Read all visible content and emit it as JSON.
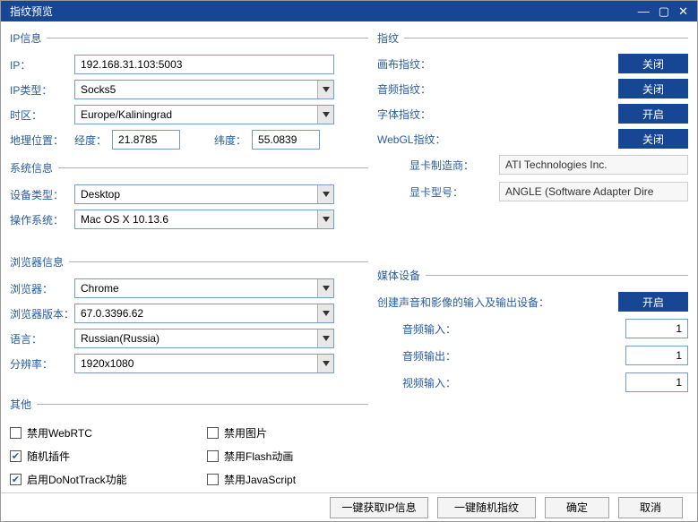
{
  "window": {
    "title": "指纹预览"
  },
  "sections": {
    "ip": "IP信息",
    "sys": "系统信息",
    "browser": "浏览器信息",
    "other": "其他",
    "fp": "指纹",
    "media": "媒体设备"
  },
  "ip": {
    "ip_label": "IP：",
    "ip_value": "192.168.31.103:5003",
    "type_label": "IP类型：",
    "type_value": "Socks5",
    "tz_label": "时区：",
    "tz_value": "Europe/Kaliningrad",
    "geo_label": "地理位置：",
    "lng_label": "经度：",
    "lng_value": "21.8785",
    "lat_label": "纬度：",
    "lat_value": "55.0839"
  },
  "sys": {
    "device_label": "设备类型：",
    "device_value": "Desktop",
    "os_label": "操作系统：",
    "os_value": "Mac OS X 10.13.6"
  },
  "browser": {
    "name_label": "浏览器：",
    "name_value": "Chrome",
    "ver_label": "浏览器版本：",
    "ver_value": "67.0.3396.62",
    "lang_label": "语言：",
    "lang_value": "Russian(Russia)",
    "res_label": "分辨率：",
    "res_value": "1920x1080"
  },
  "other": {
    "disable_webrtc": "禁用WebRTC",
    "random_plugin": "随机插件",
    "enable_dnt": "启用DoNotTrack功能",
    "disable_image": "禁用图片",
    "disable_flash": "禁用Flash动画",
    "disable_js": "禁用JavaScript"
  },
  "fp": {
    "canvas_label": "画布指纹：",
    "canvas_state": "关闭",
    "audio_label": "音频指纹：",
    "audio_state": "关闭",
    "font_label": "字体指纹：",
    "font_state": "开启",
    "webgl_label": "WebGL指纹：",
    "webgl_state": "关闭",
    "gpu_vendor_label": "显卡制造商：",
    "gpu_vendor_value": "ATI Technologies Inc.",
    "gpu_model_label": "显卡型号：",
    "gpu_model_value": "ANGLE (Software Adapter Dire"
  },
  "media": {
    "create_label": "创建声音和影像的输入及输出设备：",
    "create_state": "开启",
    "audio_in_label": "音频输入：",
    "audio_in_value": "1",
    "audio_out_label": "音频输出：",
    "audio_out_value": "1",
    "video_in_label": "视频输入：",
    "video_in_value": "1"
  },
  "footer": {
    "fetch_ip": "一键获取IP信息",
    "random_fp": "一键随机指纹",
    "ok": "确定",
    "cancel": "取消"
  }
}
